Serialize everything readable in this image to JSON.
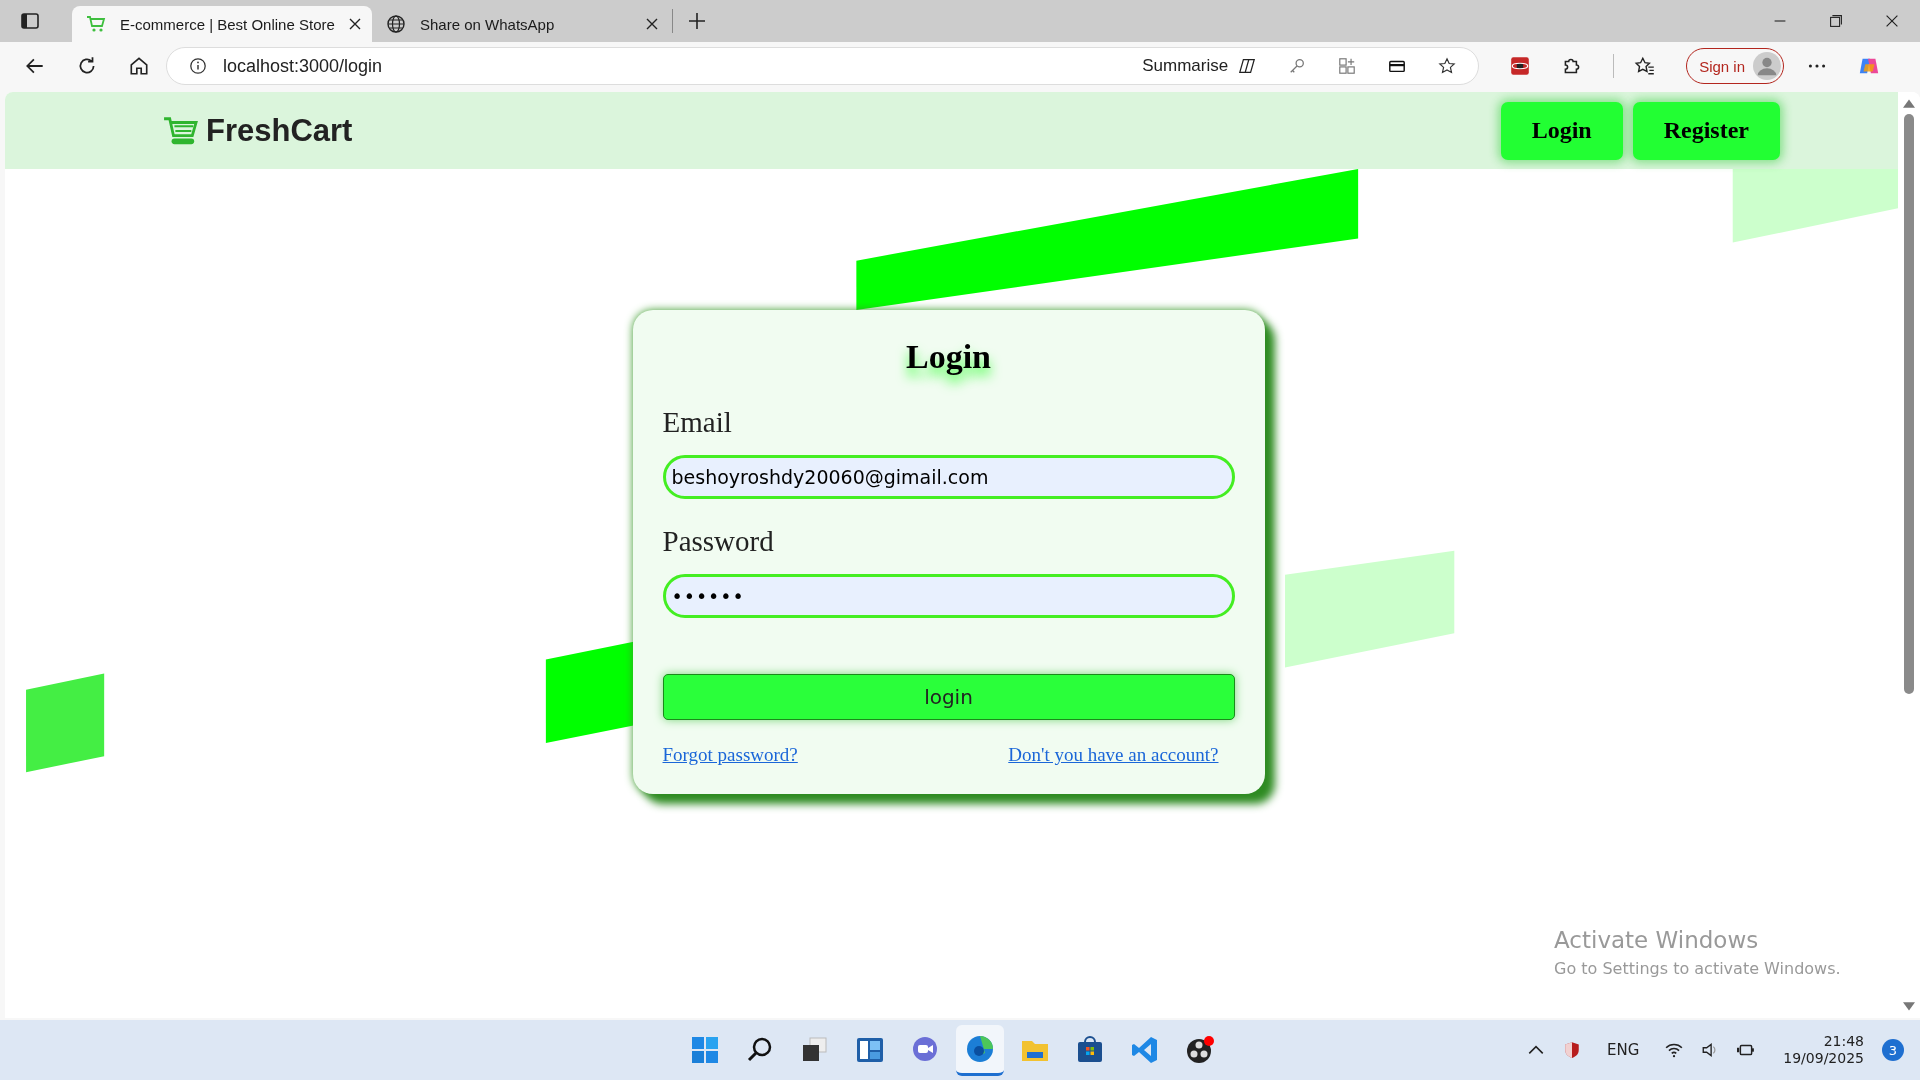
{
  "browser": {
    "tabs": [
      {
        "title": "E-commerce | Best Online Store",
        "selected": true
      },
      {
        "title": "Share on WhatsApp",
        "selected": false
      }
    ],
    "url": "localhost:3000/login",
    "summarise": "Summarise",
    "sign_in": "Sign in"
  },
  "navbar": {
    "brand": "FreshCart",
    "buttons": [
      "Login",
      "Register"
    ]
  },
  "login_card": {
    "title": "Login",
    "fields": [
      {
        "label": "Email",
        "value": "beshoyroshdy20060@gimail.com",
        "kind": "email"
      },
      {
        "label": "Password",
        "value": "••••••",
        "kind": "password"
      }
    ],
    "submit": "login",
    "links": [
      "Forgot password?",
      "Don't you have an account?"
    ]
  },
  "activation_notice": {
    "title": "Activate Windows",
    "subtitle": "Go to Settings to activate Windows."
  },
  "taskbar": {
    "language": "ENG",
    "time": "21:48",
    "date": "19/09/2025",
    "notifications": "3"
  }
}
